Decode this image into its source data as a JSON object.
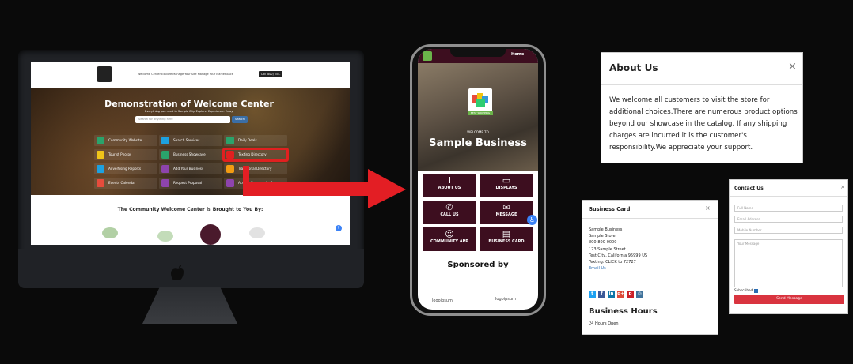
{
  "desktop_site": {
    "nav_links": "Welcome Center    Explore    Manage Your Site    Manage Your Marketplace",
    "call_button": "Call (800) 555-0000",
    "hero_title": "Demonstration of Welcome Center",
    "hero_subtitle": "Everything you need in Sample City. Explore. Experience. Enjoy.",
    "search_placeholder": "Search for anything here",
    "search_button": "Search",
    "menu": [
      {
        "label": "Community Website",
        "color": "#2aa36b"
      },
      {
        "label": "Search Services",
        "color": "#1da1e0"
      },
      {
        "label": "Daily Deals",
        "color": "#2aa36b"
      },
      {
        "label": "Tourist Photos",
        "color": "#f0c419"
      },
      {
        "label": "Business Showcase",
        "color": "#2aa36b"
      },
      {
        "label": "Texting Directory",
        "color": "#e02020"
      },
      {
        "label": "Advertising Reports",
        "color": "#1da1e0"
      },
      {
        "label": "Add Your Business",
        "color": "#8e44ad"
      },
      {
        "label": "Traditional Directory",
        "color": "#f39c12"
      },
      {
        "label": "Events Calendar",
        "color": "#e74c3c"
      },
      {
        "label": "Request Proposal",
        "color": "#8e44ad"
      },
      {
        "label": "Access Community App",
        "color": "#8e44ad"
      }
    ],
    "brought_to_you": "The Community Welcome Center is Brought to You By:"
  },
  "phone": {
    "home_link": "Home",
    "logo_band": "BEST SHOPPING",
    "welcome_to": "WELCOME TO",
    "business_name": "Sample Business",
    "tiles": [
      {
        "label": "ABOUT US",
        "icon": "info-icon"
      },
      {
        "label": "DISPLAYS",
        "icon": "store-icon"
      },
      {
        "label": "CALL US",
        "icon": "phone-icon"
      },
      {
        "label": "MESSAGE",
        "icon": "message-icon"
      },
      {
        "label": "COMMUNITY APP",
        "icon": "community-icon"
      },
      {
        "label": "BUSINESS CARD",
        "icon": "card-icon"
      }
    ],
    "sponsored_by": "Sponsored by",
    "sponsor_1": "logoipsum",
    "sponsor_2": "logoipsum"
  },
  "about": {
    "title": "About Us",
    "close": "×",
    "body": "We welcome all customers to visit the store for additional choices.There are numerous product options beyond our showcase in the catalog. If any shipping charges are incurred it is the customer's responsibility.We appreciate your support."
  },
  "business_card": {
    "title": "Business Card",
    "close": "×",
    "lines": [
      "Sample Business",
      "Sample Store",
      "800-800-0000",
      "123 Sample Street",
      "Test City, California 95999 US",
      "Texting: CLICK to 72727"
    ],
    "email": "Email Us",
    "social": [
      {
        "label": "t",
        "color": "#1da1f2",
        "icon": "twitter-icon"
      },
      {
        "label": "f",
        "color": "#3b5998",
        "icon": "facebook-icon"
      },
      {
        "label": "in",
        "color": "#0e76a8",
        "icon": "linkedin-icon"
      },
      {
        "label": "g+",
        "color": "#dd4b39",
        "icon": "googleplus-icon"
      },
      {
        "label": "p",
        "color": "#cb2027",
        "icon": "pinterest-icon"
      },
      {
        "label": "◎",
        "color": "#3f729b",
        "icon": "instagram-icon"
      }
    ],
    "hours_title": "Business Hours",
    "hours": "24 Hours Open"
  },
  "contact": {
    "title": "Contact Us",
    "close": "×",
    "full_name": "Full Name",
    "email": "Email Address",
    "mobile": "Mobile Number",
    "message": "Your Message",
    "subscribed": "Subscribed",
    "send": "Send Message"
  }
}
